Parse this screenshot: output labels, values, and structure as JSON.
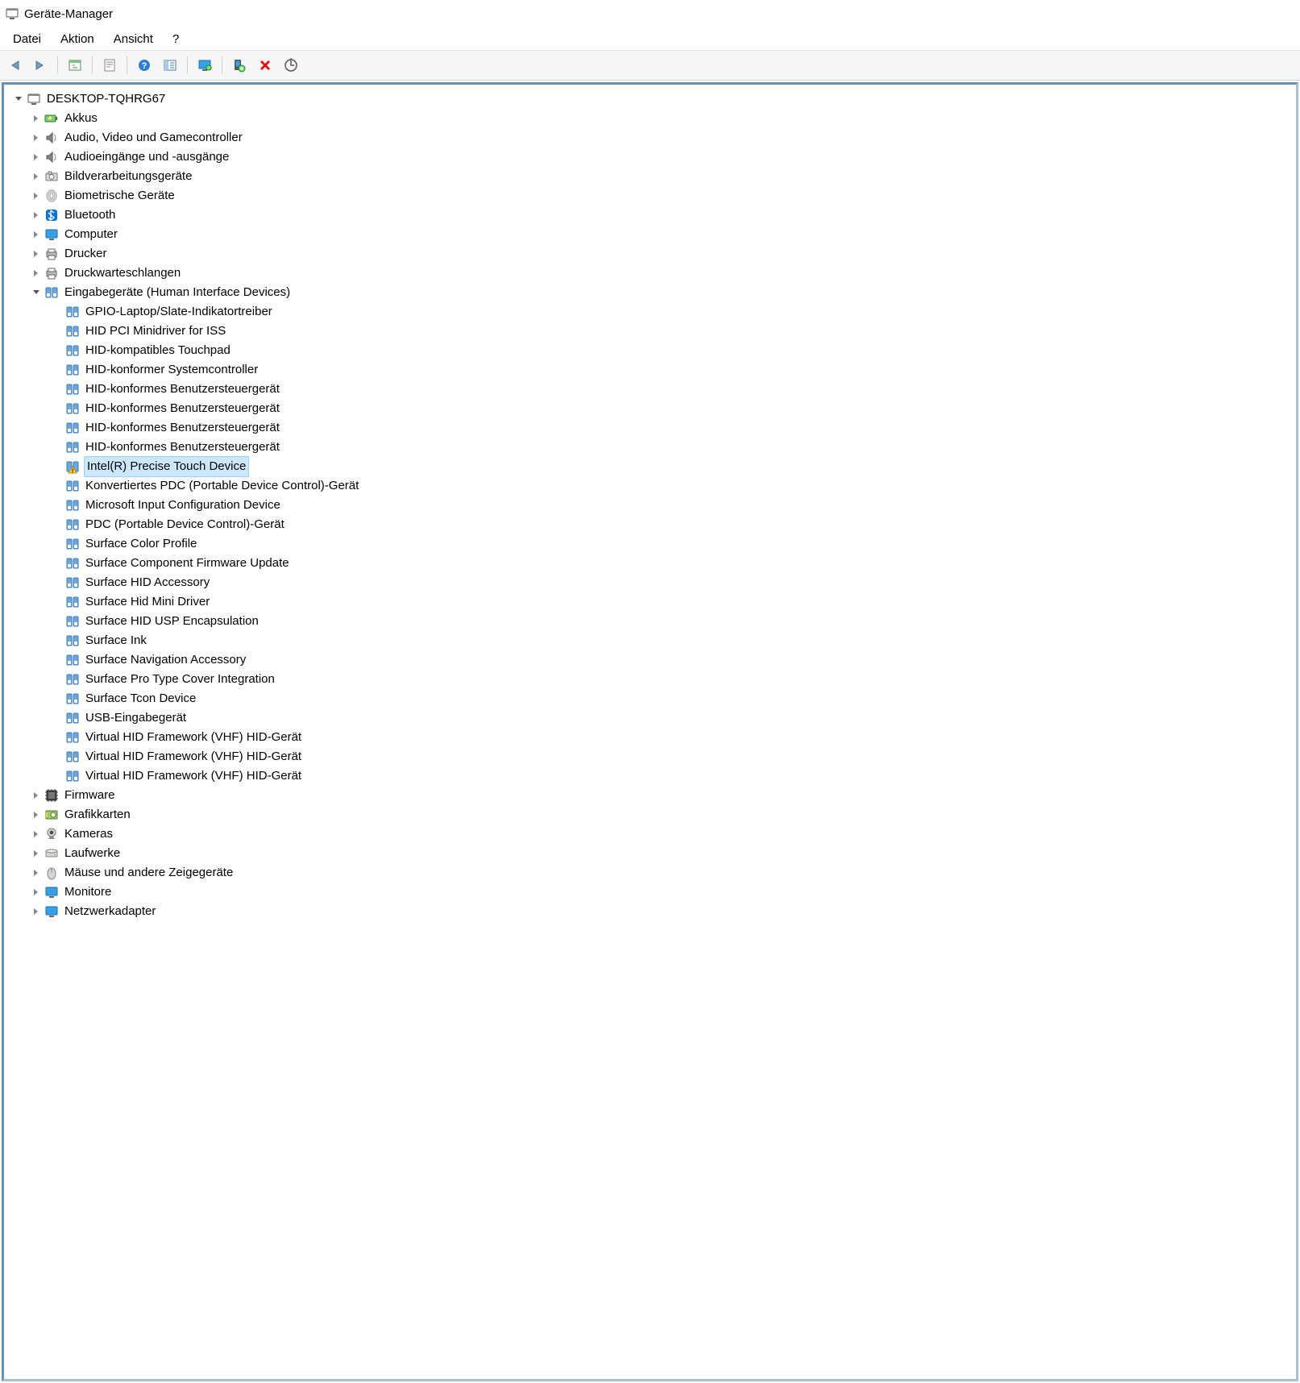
{
  "window": {
    "title": "Geräte-Manager"
  },
  "menu": {
    "file": "Datei",
    "action": "Aktion",
    "view": "Ansicht",
    "help": "?"
  },
  "root": {
    "label": "DESKTOP-TQHRG67"
  },
  "categories_top": [
    {
      "id": "akkus",
      "label": "Akkus",
      "icon": "battery"
    },
    {
      "id": "audio-video",
      "label": "Audio, Video und Gamecontroller",
      "icon": "speaker"
    },
    {
      "id": "audio-io",
      "label": "Audioeingänge und -ausgänge",
      "icon": "speaker"
    },
    {
      "id": "imaging",
      "label": "Bildverarbeitungsgeräte",
      "icon": "camera-sm"
    },
    {
      "id": "biometric",
      "label": "Biometrische Geräte",
      "icon": "fingerprint"
    },
    {
      "id": "bluetooth",
      "label": "Bluetooth",
      "icon": "bt"
    },
    {
      "id": "computer",
      "label": "Computer",
      "icon": "monitor"
    },
    {
      "id": "printers",
      "label": "Drucker",
      "icon": "printer"
    },
    {
      "id": "queues",
      "label": "Druckwarteschlangen",
      "icon": "printer"
    }
  ],
  "hid_category": {
    "label": "Eingabegeräte (Human Interface Devices)"
  },
  "hid_devices": [
    {
      "label": "GPIO-Laptop/Slate-Indikatortreiber"
    },
    {
      "label": "HID PCI Minidriver for ISS"
    },
    {
      "label": "HID-kompatibles Touchpad"
    },
    {
      "label": "HID-konformer Systemcontroller"
    },
    {
      "label": "HID-konformes Benutzersteuergerät"
    },
    {
      "label": "HID-konformes Benutzersteuergerät"
    },
    {
      "label": "HID-konformes Benutzersteuergerät"
    },
    {
      "label": "HID-konformes Benutzersteuergerät"
    },
    {
      "label": "Intel(R) Precise Touch Device",
      "warning": true,
      "selected": true
    },
    {
      "label": "Konvertiertes PDC (Portable Device Control)-Gerät"
    },
    {
      "label": "Microsoft Input Configuration Device"
    },
    {
      "label": "PDC (Portable Device Control)-Gerät"
    },
    {
      "label": "Surface Color Profile"
    },
    {
      "label": "Surface Component Firmware Update"
    },
    {
      "label": "Surface HID Accessory"
    },
    {
      "label": "Surface Hid Mini Driver"
    },
    {
      "label": "Surface HID USP Encapsulation"
    },
    {
      "label": "Surface Ink"
    },
    {
      "label": "Surface Navigation Accessory"
    },
    {
      "label": "Surface Pro Type Cover Integration"
    },
    {
      "label": "Surface Tcon Device"
    },
    {
      "label": "USB-Eingabegerät"
    },
    {
      "label": "Virtual HID Framework (VHF) HID-Gerät"
    },
    {
      "label": "Virtual HID Framework (VHF) HID-Gerät"
    },
    {
      "label": "Virtual HID Framework (VHF) HID-Gerät"
    }
  ],
  "categories_bottom": [
    {
      "id": "firmware",
      "label": "Firmware",
      "icon": "chip"
    },
    {
      "id": "gpu",
      "label": "Grafikkarten",
      "icon": "gpu"
    },
    {
      "id": "cameras",
      "label": "Kameras",
      "icon": "webcam"
    },
    {
      "id": "drives",
      "label": "Laufwerke",
      "icon": "disk"
    },
    {
      "id": "mice",
      "label": "Mäuse und andere Zeigegeräte",
      "icon": "mouse"
    },
    {
      "id": "monitors",
      "label": "Monitore",
      "icon": "monitor"
    },
    {
      "id": "network",
      "label": "Netzwerkadapter",
      "icon": "monitor"
    }
  ]
}
